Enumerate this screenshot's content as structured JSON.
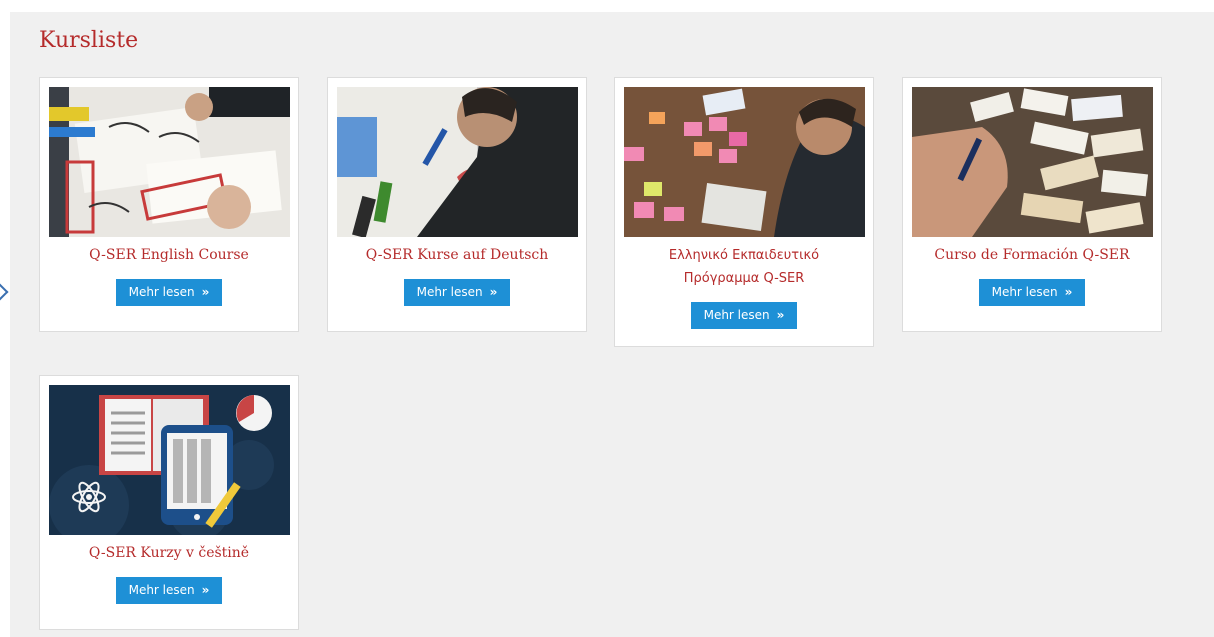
{
  "page": {
    "title": "Kursliste"
  },
  "colors": {
    "accent": "#b52b2b",
    "button": "#1e90d6",
    "panel": "#f0f0f0"
  },
  "courses": [
    {
      "title": "Q-SER English Course",
      "button_label": "Mehr lesen",
      "button_icon": "double-chevron-right-icon",
      "image": "workshop-paper-writing-photo"
    },
    {
      "title": "Q-SER Kurse auf Deutsch",
      "button_label": "Mehr lesen",
      "button_icon": "double-chevron-right-icon",
      "image": "workshop-drawing-photo"
    },
    {
      "title_line1": "Ελληνικό Εκπαιδευτικό",
      "title_line2": "Πρόγραμμα Q-SER",
      "button_label": "Mehr lesen",
      "button_icon": "double-chevron-right-icon",
      "image": "sticky-notes-photo"
    },
    {
      "title": "Curso de Formación Q-SER",
      "button_label": "Mehr lesen",
      "button_icon": "double-chevron-right-icon",
      "image": "cards-on-table-photo"
    },
    {
      "title": "Q-SER Kurzy v češtině",
      "button_label": "Mehr lesen",
      "button_icon": "double-chevron-right-icon",
      "image": "e-learning-illustration"
    }
  ]
}
